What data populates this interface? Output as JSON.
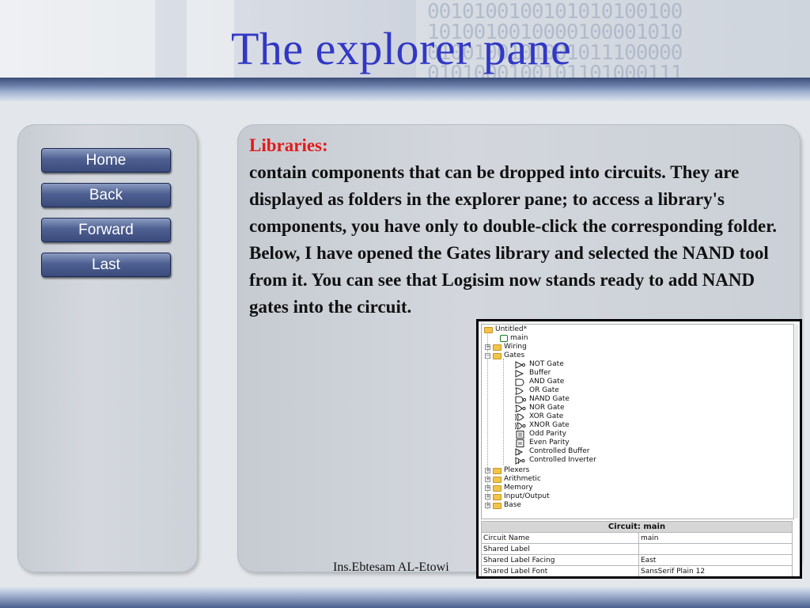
{
  "slide": {
    "title": "The explorer pane",
    "heading": "Libraries:",
    "body": " contain components that can be dropped into circuits. They are displayed as folders in the explorer pane; to access a library's components, you have only to double-click the corresponding folder. Below, I have opened the Gates library and selected the NAND tool from it. You can see that Logisim now stands ready to add NAND gates into the circuit.",
    "credit": "Ins.Ebtesam AL-Etowi",
    "binary_background": "0010100100101010100100\n1010010010000100001010\n0100100101001011100000\n0101000100101101000111"
  },
  "nav": {
    "home": "Home",
    "back": "Back",
    "forward": "Forward",
    "last": "Last"
  },
  "explorer": {
    "tree": {
      "project": "Untitled*",
      "circuit": "main",
      "libraries": [
        "Wiring",
        "Gates",
        "Plexers",
        "Arithmetic",
        "Memory",
        "Input/Output",
        "Base"
      ],
      "gates": [
        "NOT Gate",
        "Buffer",
        "AND Gate",
        "OR Gate",
        "NAND Gate",
        "NOR Gate",
        "XOR Gate",
        "XNOR Gate",
        "Odd Parity",
        "Even Parity",
        "Controlled Buffer",
        "Controlled Inverter"
      ]
    },
    "properties": {
      "header": "Circuit: main",
      "rows": [
        {
          "key": "Circuit Name",
          "value": "main"
        },
        {
          "key": "Shared Label",
          "value": ""
        },
        {
          "key": "Shared Label Facing",
          "value": "East"
        },
        {
          "key": "Shared Label Font",
          "value": "SansSerif Plain 12"
        }
      ]
    }
  },
  "colors": {
    "title": "#3138c5",
    "heading": "#e11a1a",
    "button": "#4e6091",
    "folder": "#f2c44a"
  },
  "icons": {
    "folder": "folder-icon",
    "circuit": "circuit-icon",
    "expander": "expander-icon"
  }
}
